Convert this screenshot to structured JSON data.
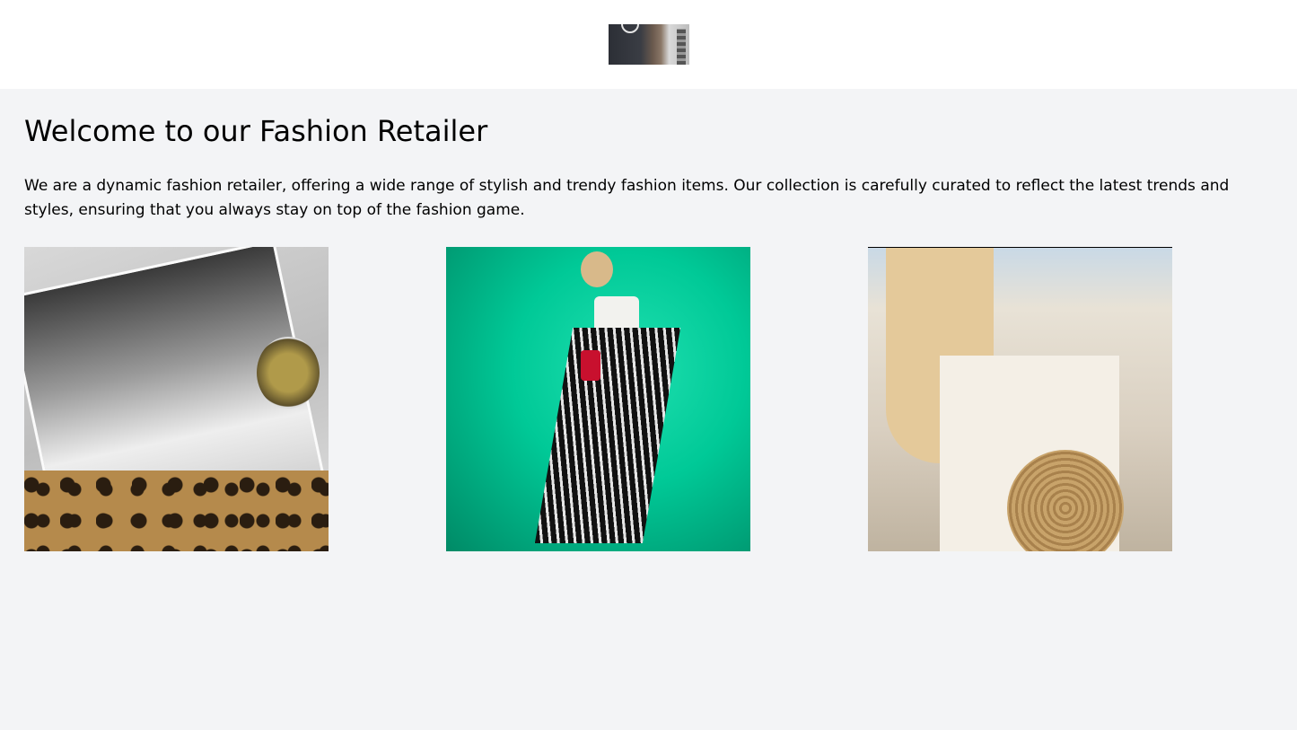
{
  "header": {
    "logo_icon": "city-clock-tower-logo"
  },
  "main": {
    "title": "Welcome to our Fashion Retailer",
    "intro": "We are a dynamic fashion retailer, offering a wide range of stylish and trendy fashion items. Our collection is carefully curated to reflect the latest trends and styles, ensuring that you always stay on top of the fashion game.",
    "gallery": [
      {
        "icon": "magazine-photo"
      },
      {
        "icon": "striped-pants-photo"
      },
      {
        "icon": "white-dress-photo"
      }
    ]
  },
  "colors": {
    "page_bg": "#f3f4f6",
    "header_bg": "#ffffff",
    "text": "#000000"
  }
}
